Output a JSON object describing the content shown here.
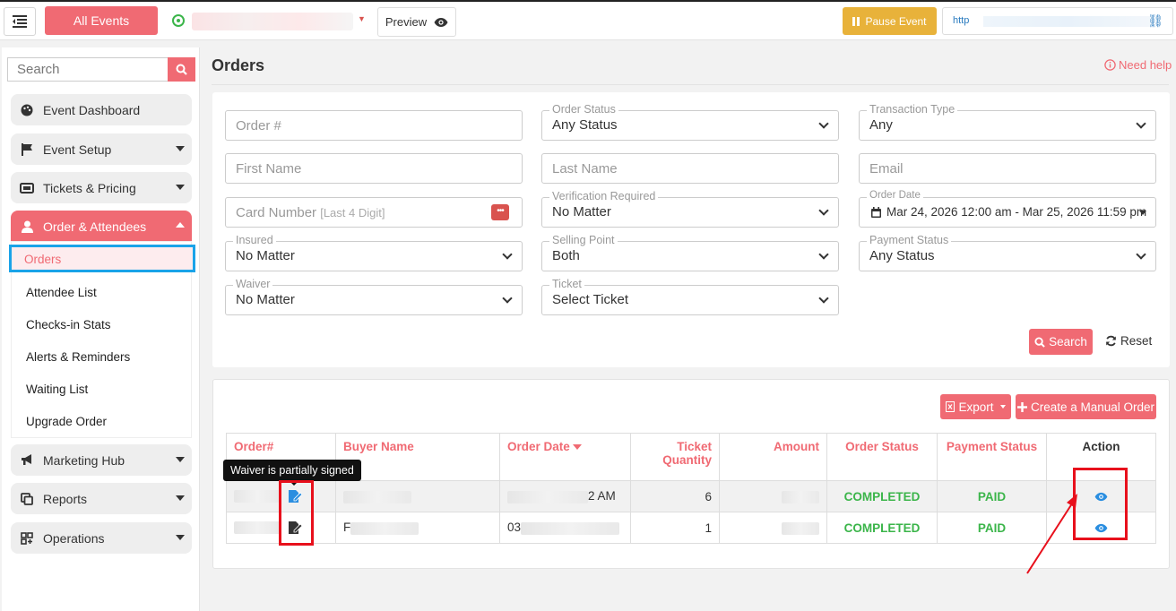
{
  "topbar": {
    "all_events": "All Events",
    "preview": "Preview",
    "pause_event": "Pause Event",
    "url_text": "http"
  },
  "sidebar": {
    "search_placeholder": "Search",
    "items": [
      {
        "label": "Event Dashboard",
        "icon": "palette-icon"
      },
      {
        "label": "Event Setup",
        "icon": "flag-icon"
      },
      {
        "label": "Tickets & Pricing",
        "icon": "ticket-icon"
      },
      {
        "label": "Order & Attendees",
        "icon": "user-icon"
      },
      {
        "label": "Marketing Hub",
        "icon": "megaphone-icon"
      },
      {
        "label": "Reports",
        "icon": "copy-icon"
      },
      {
        "label": "Operations",
        "icon": "grid-icon"
      }
    ],
    "submenu": [
      "Orders",
      "Attendee List",
      "Checks-in Stats",
      "Alerts & Reminders",
      "Waiting List",
      "Upgrade Order"
    ]
  },
  "page": {
    "title": "Orders",
    "help": "Need help"
  },
  "filters": {
    "order_no_placeholder": "Order #",
    "order_status_label": "Order Status",
    "order_status_value": "Any Status",
    "transaction_type_label": "Transaction Type",
    "transaction_type_value": "Any",
    "first_name_placeholder": "First Name",
    "last_name_placeholder": "Last Name",
    "email_placeholder": "Email",
    "card_number_placeholder": "Card Number",
    "card_number_hint": "[Last 4 Digit]",
    "verification_label": "Verification Required",
    "verification_value": "No Matter",
    "order_date_label": "Order Date",
    "order_date_value": "Mar 24, 2026 12:00 am - Mar 25, 2026 11:59 pm",
    "insured_label": "Insured",
    "insured_value": "No Matter",
    "selling_point_label": "Selling Point",
    "selling_point_value": "Both",
    "payment_status_label": "Payment Status",
    "payment_status_value": "Any Status",
    "waiver_label": "Waiver",
    "waiver_value": "No Matter",
    "ticket_label": "Ticket",
    "ticket_value": "Select Ticket",
    "search_button": "Search",
    "reset_button": "Reset"
  },
  "orders": {
    "export_button": "Export",
    "manual_order_button": "Create a Manual Order",
    "columns": [
      "Order#",
      "Buyer Name",
      "Order Date",
      "Ticket Quantity",
      "Amount",
      "Order Status",
      "Payment Status",
      "Action"
    ],
    "rows": [
      {
        "date_visible": "2 AM",
        "quantity": "6",
        "order_status": "COMPLETED",
        "payment_status": "PAID"
      },
      {
        "buyer_visible": "F",
        "date_visible": "03",
        "quantity": "1",
        "order_status": "COMPLETED",
        "payment_status": "PAID"
      }
    ],
    "tooltip": "Waiver is partially signed"
  },
  "colors": {
    "accent": "#f06a73",
    "success": "#3bb54a",
    "warning": "#e8b23a",
    "highlight_blue": "#1aa3e8",
    "annotation_red": "#e8101c"
  }
}
